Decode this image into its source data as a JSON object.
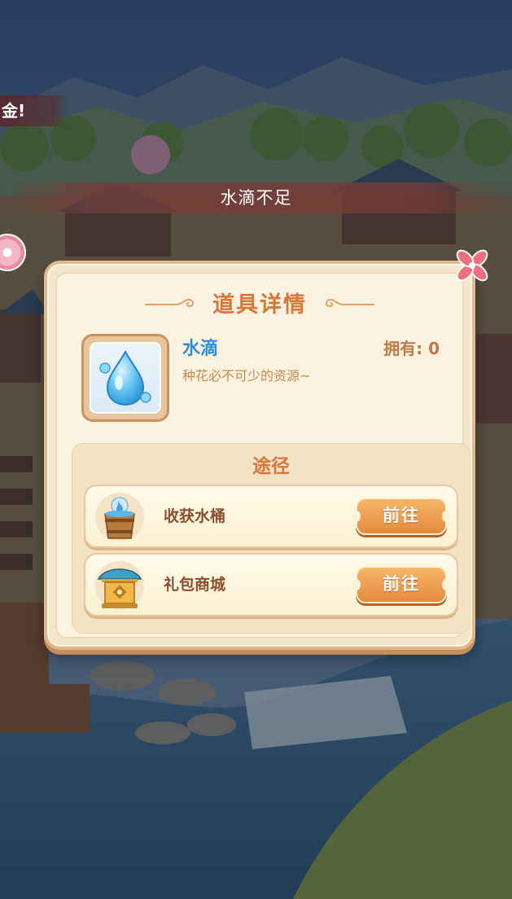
{
  "hud": {
    "edge_banner_text": "金!"
  },
  "toast": {
    "text": "水滴不足"
  },
  "dialog": {
    "title": "道具详情",
    "item": {
      "name": "水滴",
      "description": "种花必不可少的资源~",
      "owned_label": "拥有: 0",
      "icon": "water-drop-icon"
    },
    "sources": {
      "title": "途径",
      "rows": [
        {
          "label": "收获水桶",
          "icon": "water-bucket-icon",
          "button": "前往"
        },
        {
          "label": "礼包商城",
          "icon": "gift-shop-icon",
          "button": "前往"
        }
      ]
    }
  },
  "colors": {
    "title_orange": "#d9773a",
    "item_name_blue": "#2e8fd6",
    "button_orange": "#e48a3c",
    "close_pink": "#ef6f7d"
  }
}
